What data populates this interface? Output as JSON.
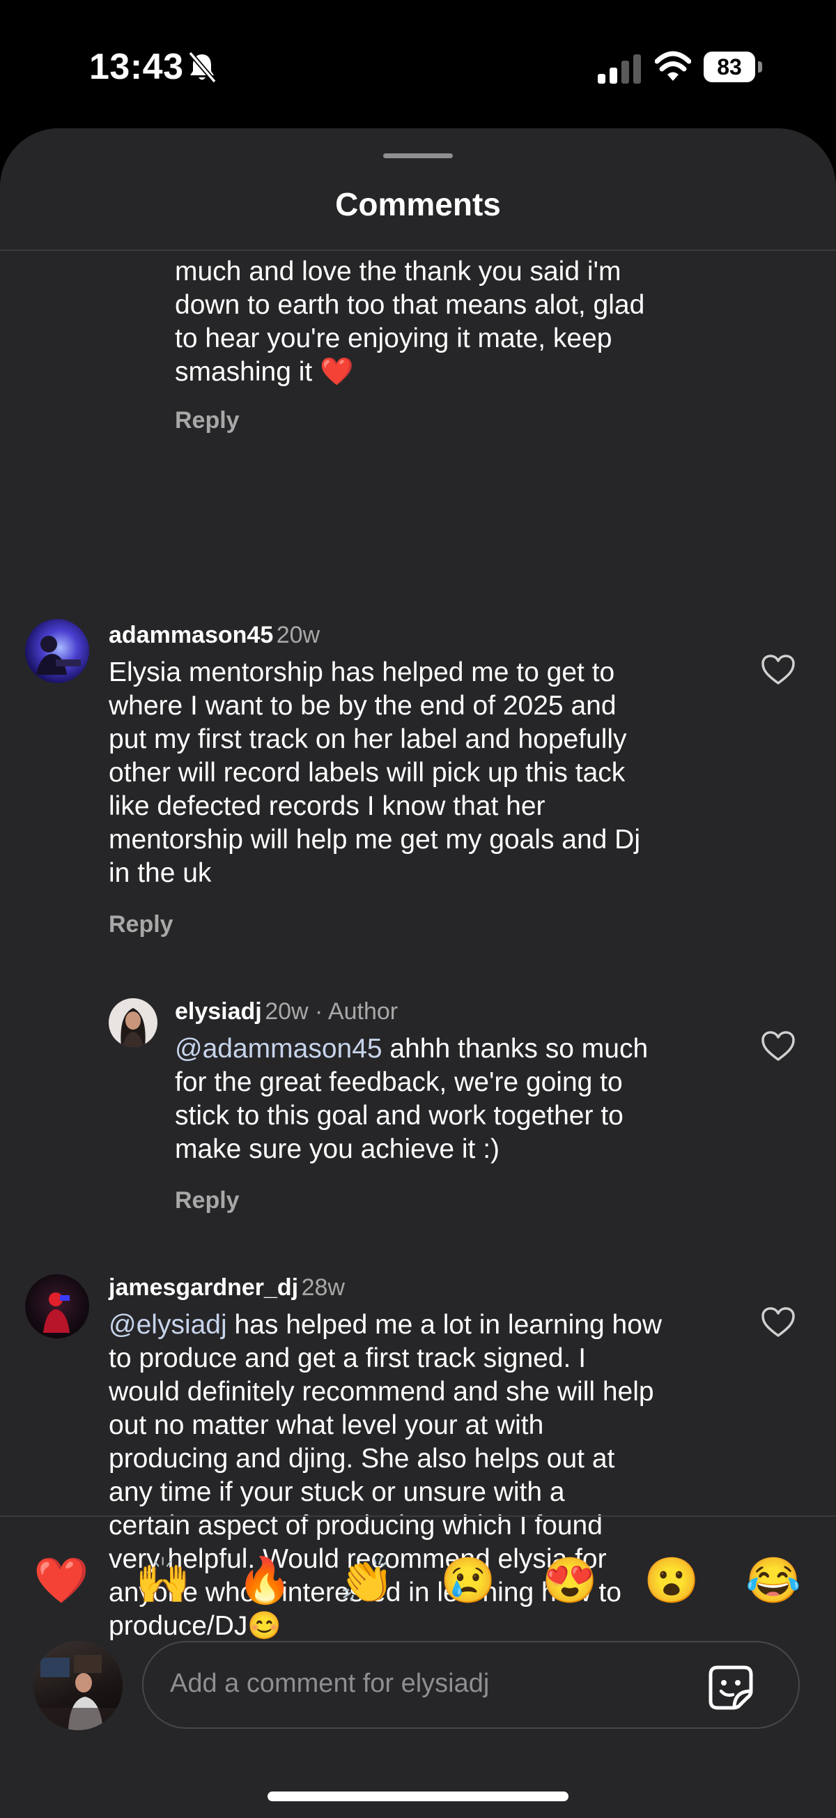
{
  "status": {
    "time": "13:43",
    "battery": "83"
  },
  "sheet": {
    "title": "Comments"
  },
  "comments": [
    {
      "text": "much and love the thank you said i'm\ndown to earth too that means alot, glad\nto hear you're enjoying it mate, keep\nsmashing it ❤️",
      "reply": "Reply"
    },
    {
      "username": "adammason45",
      "time": "20w",
      "text": "Elysia mentorship has helped me to get to\nwhere I want to be by the end of 2025 and\nput my first track on her label and hopefully\nother will  record labels will pick up this tack\nlike defected records I know that her\nmentorship will help me get my goals  and Dj\nin the uk",
      "reply": "Reply"
    },
    {
      "username": "elysiadj",
      "time": "20w · Author",
      "mention": "@adammason45",
      "text": " ahhh thanks so much\nfor the great feedback, we're going to\nstick to this goal and work together to\nmake sure you achieve it :)",
      "reply": "Reply"
    },
    {
      "username": "jamesgardner_dj",
      "time": "28w",
      "mention": "@elysiadj",
      "text": " has helped me a lot in learning how\nto produce and get a first track signed. I\nwould definitely recommend and she will help\nout no matter what level your at with\nproducing and djing. She also helps out at\nany time  if your stuck or unsure with a\ncertain aspect of producing which I found\nvery helpful. Would recommend elysia for\nanyone who's interested in learning how to\nproduce/DJ😊"
    }
  ],
  "reactions": [
    "❤️",
    "🙌",
    "🔥",
    "👏",
    "😢",
    "😍",
    "😮",
    "😂"
  ],
  "composer": {
    "placeholder": "Add a comment for elysiadj"
  },
  "icons": {
    "like": "heart-outline-icon",
    "sticker": "sticker-icon",
    "mute": "bell-slash-icon"
  }
}
